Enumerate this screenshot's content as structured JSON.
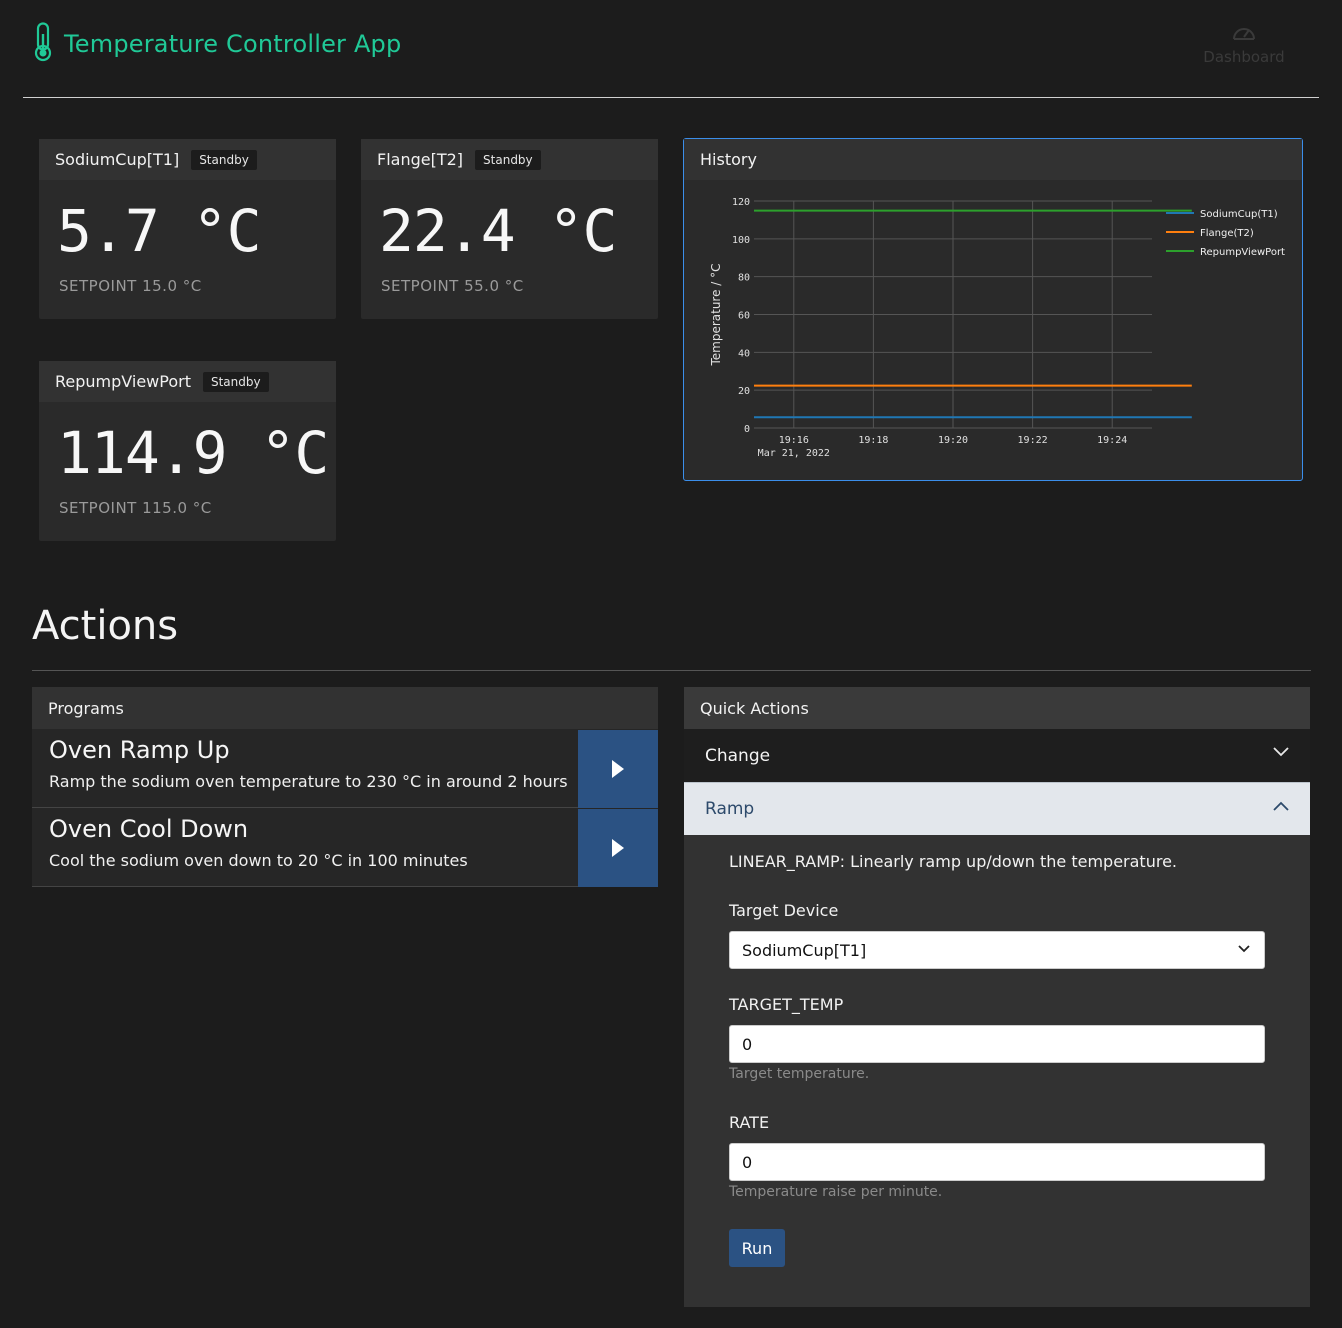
{
  "header": {
    "app_title": "Temperature Controller App",
    "nav_dashboard": "Dashboard"
  },
  "devices": [
    {
      "name": "SodiumCup[T1]",
      "status": "Standby",
      "temperature": "5.7 °C",
      "setpoint": "SETPOINT 15.0 °C"
    },
    {
      "name": "Flange[T2]",
      "status": "Standby",
      "temperature": "22.4 °C",
      "setpoint": "SETPOINT 55.0 °C"
    },
    {
      "name": "RepumpViewPort",
      "status": "Standby",
      "temperature": "114.9 °C",
      "setpoint": "SETPOINT 115.0 °C"
    }
  ],
  "history": {
    "title": "History"
  },
  "chart_data": {
    "type": "line",
    "title": "",
    "xlabel": "",
    "x_date_label": "Mar 21, 2022",
    "ylabel": "Temperature / °C",
    "x_ticks": [
      "19:16",
      "19:18",
      "19:20",
      "19:22",
      "19:24"
    ],
    "x_range": [
      "19:16",
      "19:26"
    ],
    "ylim": [
      0,
      120
    ],
    "y_ticks": [
      0,
      20,
      40,
      60,
      80,
      100,
      120
    ],
    "grid": true,
    "legend_position": "right",
    "x": [
      "19:15",
      "19:26"
    ],
    "series": [
      {
        "name": "SodiumCup(T1)",
        "color": "#1f77b4",
        "values": [
          5.7,
          5.7
        ]
      },
      {
        "name": "Flange(T2)",
        "color": "#ff7f0e",
        "values": [
          22.4,
          22.4
        ]
      },
      {
        "name": "RepumpViewPort",
        "color": "#2ca02c",
        "values": [
          114.9,
          114.9
        ]
      }
    ]
  },
  "actions": {
    "title": "Actions",
    "programs": {
      "title": "Programs",
      "items": [
        {
          "name": "Oven Ramp Up",
          "description": "Ramp the sodium oven temperature to 230 °C in around 2 hours"
        },
        {
          "name": "Oven Cool Down",
          "description": "Cool the sodium oven down to 20 °C in 100 minutes"
        }
      ]
    },
    "quick": {
      "title": "Quick Actions",
      "change_label": "Change",
      "ramp_label": "Ramp",
      "ramp_description": "LINEAR_RAMP: Linearly ramp up/down the temperature.",
      "target_device_label": "Target Device",
      "target_device_value": "SodiumCup[T1]",
      "target_temp_label": "TARGET_TEMP",
      "target_temp_value": "0",
      "target_temp_help": "Target temperature.",
      "rate_label": "RATE",
      "rate_value": "0",
      "rate_help": "Temperature raise per minute.",
      "run_label": "Run"
    }
  },
  "colors": {
    "brand": "#20c997",
    "primary_button": "#2b5283",
    "history_border": "#3b8eea"
  }
}
